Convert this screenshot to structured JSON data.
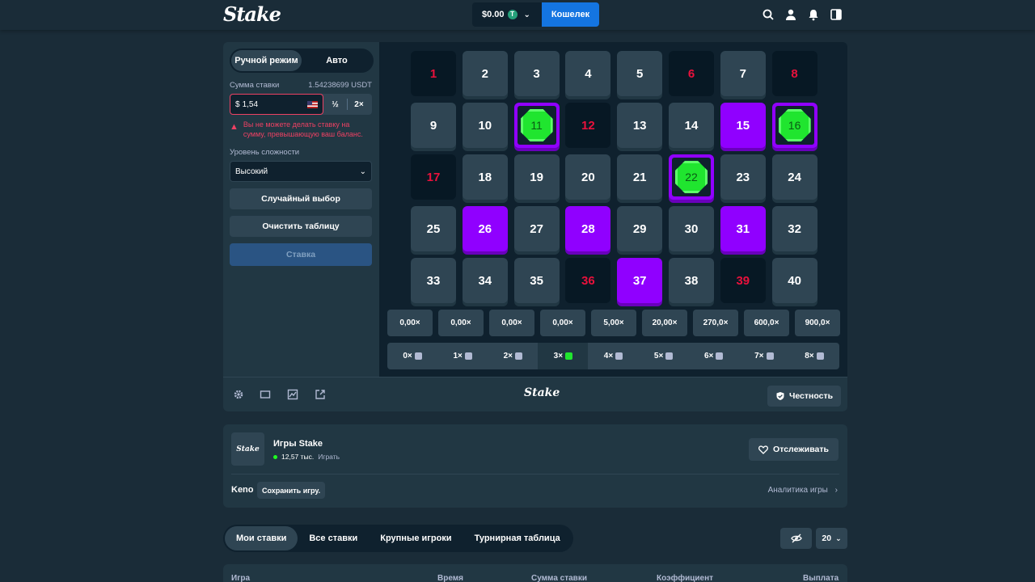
{
  "header": {
    "logo": "Stake",
    "balance": "$0.00",
    "coin_symbol": "T",
    "wallet_label": "Кошелек",
    "icons": [
      "search-icon",
      "user-icon",
      "notifications-icon",
      "sidebar-toggle-icon"
    ]
  },
  "sidebar": {
    "tabs": [
      "Ручной режим",
      "Авто"
    ],
    "bet_label": "Сумма ставки",
    "bet_usdt": "1.54238699 USDT",
    "bet_prefix": "$",
    "bet_value": "1,54",
    "half_label": "½",
    "double_label": "2×",
    "error_text": "Вы не можете делать ставку на сумму, превышающую ваш баланс.",
    "difficulty_label": "Уровень сложности",
    "difficulty_value": "Высокий",
    "random_label": "Случайный выбор",
    "clear_label": "Очистить таблицу",
    "bet_button": "Ставка"
  },
  "board": {
    "numbers": [
      "1",
      "2",
      "3",
      "4",
      "5",
      "6",
      "7",
      "8",
      "9",
      "10",
      "11",
      "12",
      "13",
      "14",
      "15",
      "16",
      "17",
      "18",
      "19",
      "20",
      "21",
      "22",
      "23",
      "24",
      "25",
      "26",
      "27",
      "28",
      "29",
      "30",
      "31",
      "32",
      "33",
      "34",
      "35",
      "36",
      "37",
      "38",
      "39",
      "40"
    ],
    "drawn": [
      1,
      6,
      8,
      12,
      17,
      36,
      39
    ],
    "picked": [
      15,
      26,
      28,
      31,
      37
    ],
    "hits": [
      11,
      16,
      22
    ],
    "multipliers": [
      "0,00×",
      "0,00×",
      "0,00×",
      "0,00×",
      "5,00×",
      "20,00×",
      "270,0×",
      "600,0×",
      "900,0×"
    ],
    "hit_counts": [
      "0×",
      "1×",
      "2×",
      "3×",
      "4×",
      "5×",
      "6×",
      "7×",
      "8×"
    ],
    "active_hit_index": 3
  },
  "game_footer": {
    "logo": "Stake",
    "fairness_label": "Честность",
    "icons": [
      "settings-icon",
      "theatre-mode-icon",
      "stats-icon",
      "popout-icon"
    ]
  },
  "info": {
    "thumb_logo": "Stake",
    "title": "Игры Stake",
    "players": "12,57 тыс.",
    "players_suffix": "Играть",
    "follow_label": "Отслеживать",
    "game_name": "Keno",
    "save_label": "Сохранить игру.",
    "analytics_label": "Аналитика игры"
  },
  "bets": {
    "tabs": [
      "Мои ставки",
      "Все ставки",
      "Крупные игроки",
      "Турнирная таблица"
    ],
    "count_value": "20",
    "columns": [
      "Игра",
      "Время",
      "Сумма ставки",
      "Коэффициент",
      "Выплата"
    ]
  },
  "colors": {
    "bg": "#1a2c38",
    "panel": "#213743",
    "tile": "#2f4553",
    "picked": "#9000ff",
    "gem": "#20e52f",
    "drawn_text": "#e9113c",
    "wallet": "#1475e1"
  }
}
